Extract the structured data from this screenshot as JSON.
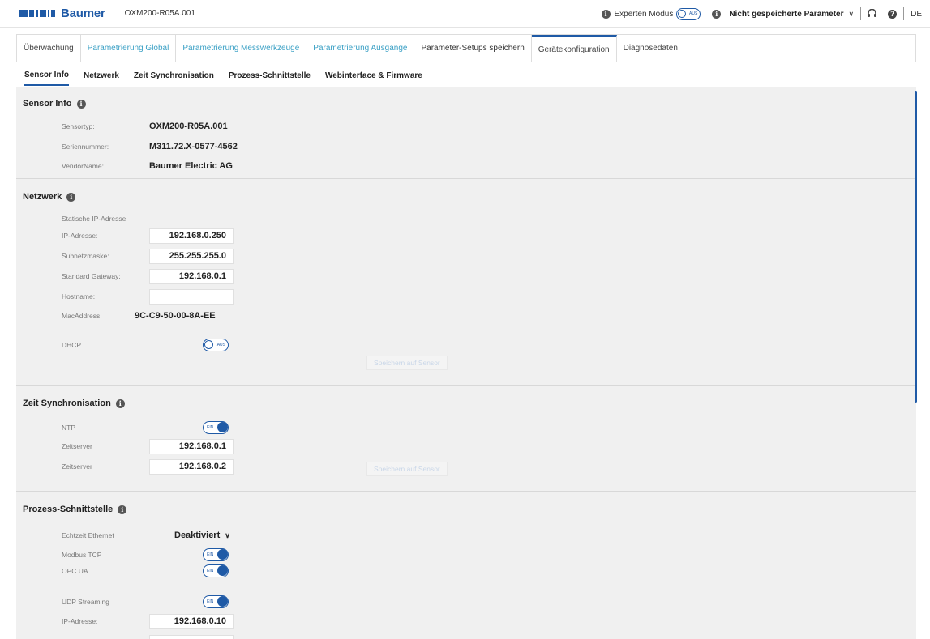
{
  "header": {
    "brand": "Baumer",
    "device": "OXM200-R05A.001",
    "expert_mode_label": "Experten Modus",
    "expert_toggle_text": "AUS",
    "unsaved_label": "Nicht gespeicherte Parameter",
    "language": "DE"
  },
  "tabs": [
    {
      "label": "Überwachung"
    },
    {
      "label": "Parametrierung Global"
    },
    {
      "label": "Parametrierung Messwerkzeuge"
    },
    {
      "label": "Parametrierung Ausgänge"
    },
    {
      "label": "Parameter-Setups speichern"
    },
    {
      "label": "Gerätekonfiguration"
    },
    {
      "label": "Diagnosedaten"
    }
  ],
  "subtabs": [
    {
      "label": "Sensor Info"
    },
    {
      "label": "Netzwerk"
    },
    {
      "label": "Zeit Synchronisation"
    },
    {
      "label": "Prozess-Schnittstelle"
    },
    {
      "label": "Webinterface & Firmware"
    }
  ],
  "sensor_info": {
    "title": "Sensor Info",
    "rows": [
      {
        "label": "Sensortyp:",
        "value": "OXM200-R05A.001"
      },
      {
        "label": "Seriennummer:",
        "value": "M311.72.X-0577-4562"
      },
      {
        "label": "VendorName:",
        "value": "Baumer Electric AG"
      }
    ]
  },
  "network": {
    "title": "Netzwerk",
    "static_ip_label": "Statische IP-Adresse",
    "ip_label": "IP-Adresse:",
    "ip_value": "192.168.0.250",
    "subnet_label": "Subnetzmaske:",
    "subnet_value": "255.255.255.0",
    "gateway_label": "Standard Gateway:",
    "gateway_value": "192.168.0.1",
    "hostname_label": "Hostname:",
    "hostname_value": "",
    "mac_label": "MacAddress:",
    "mac_value": "9C-C9-50-00-8A-EE",
    "dhcp_label": "DHCP",
    "dhcp_toggle_text": "AUS",
    "save_label": "Speichern auf Sensor"
  },
  "time_sync": {
    "title": "Zeit Synchronisation",
    "ntp_label": "NTP",
    "ntp_toggle_text": "EIN",
    "server1_label": "Zeitserver",
    "server1_value": "192.168.0.1",
    "server2_label": "Zeitserver",
    "server2_value": "192.168.0.2",
    "save_label": "Speichern auf Sensor"
  },
  "process": {
    "title": "Prozess-Schnittstelle",
    "rt_eth_label": "Echtzeit Ethernet",
    "rt_eth_value": "Deaktiviert",
    "modbus_label": "Modbus TCP",
    "modbus_toggle_text": "EIN",
    "opcua_label": "OPC UA",
    "opcua_toggle_text": "EIN",
    "udp_label": "UDP Streaming",
    "udp_toggle_text": "EIN",
    "udp_ip_label": "IP-Adresse:",
    "udp_ip_value": "192.168.0.10"
  },
  "colors": {
    "accent": "#1f5aa6",
    "link": "#3aa0c5",
    "panel": "#f0f0f0"
  }
}
